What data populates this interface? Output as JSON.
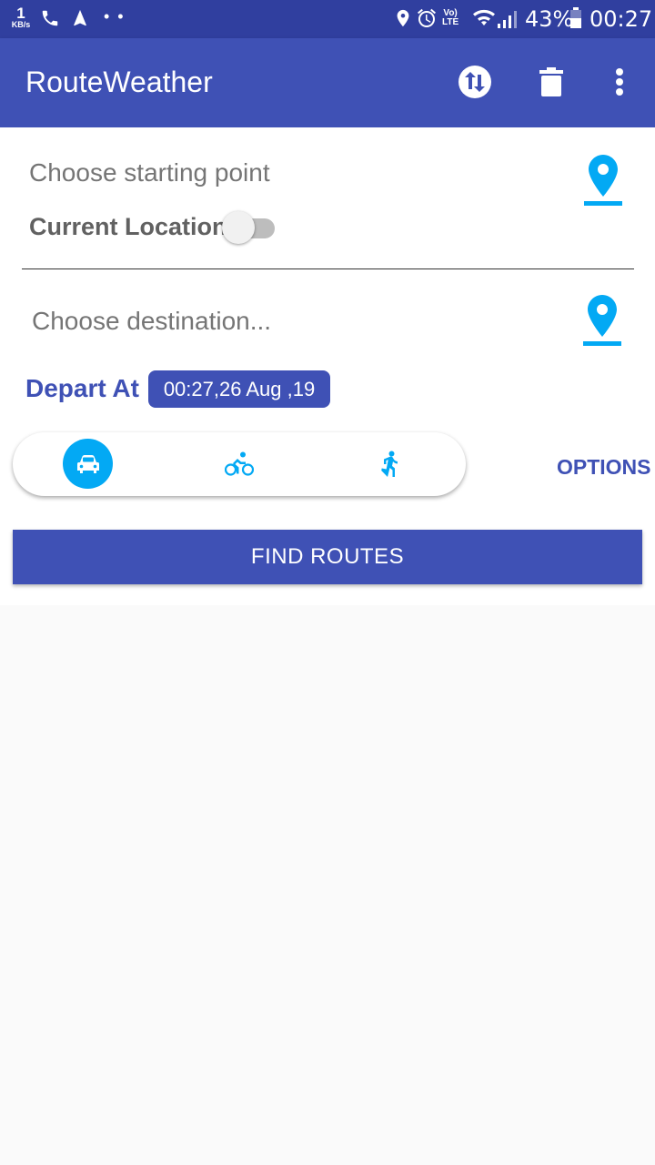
{
  "status_bar": {
    "net_speed": "1",
    "net_unit": "KB/s",
    "dots": "• •",
    "volte": "Vo)",
    "lte": "LTE",
    "battery": "43%",
    "time": "00:27"
  },
  "app_bar": {
    "title": "RouteWeather",
    "actions": [
      "swap-icon",
      "delete-icon",
      "more-vert-icon"
    ]
  },
  "form": {
    "start_placeholder": "Choose starting point",
    "current_location_label": "Current Location",
    "current_location_on": false,
    "destination_placeholder": "Choose destination...",
    "depart_label": "Depart At  :",
    "depart_value": "00:27,26 Aug ,19",
    "modes": [
      "car-icon",
      "bike-icon",
      "walk-icon"
    ],
    "selected_mode": "car-icon",
    "options_label": "OPTIONS",
    "find_button": "FIND ROUTES"
  },
  "colors": {
    "primary": "#3f51b5",
    "primary_dark": "#303f9f",
    "accent": "#03a9f4"
  }
}
